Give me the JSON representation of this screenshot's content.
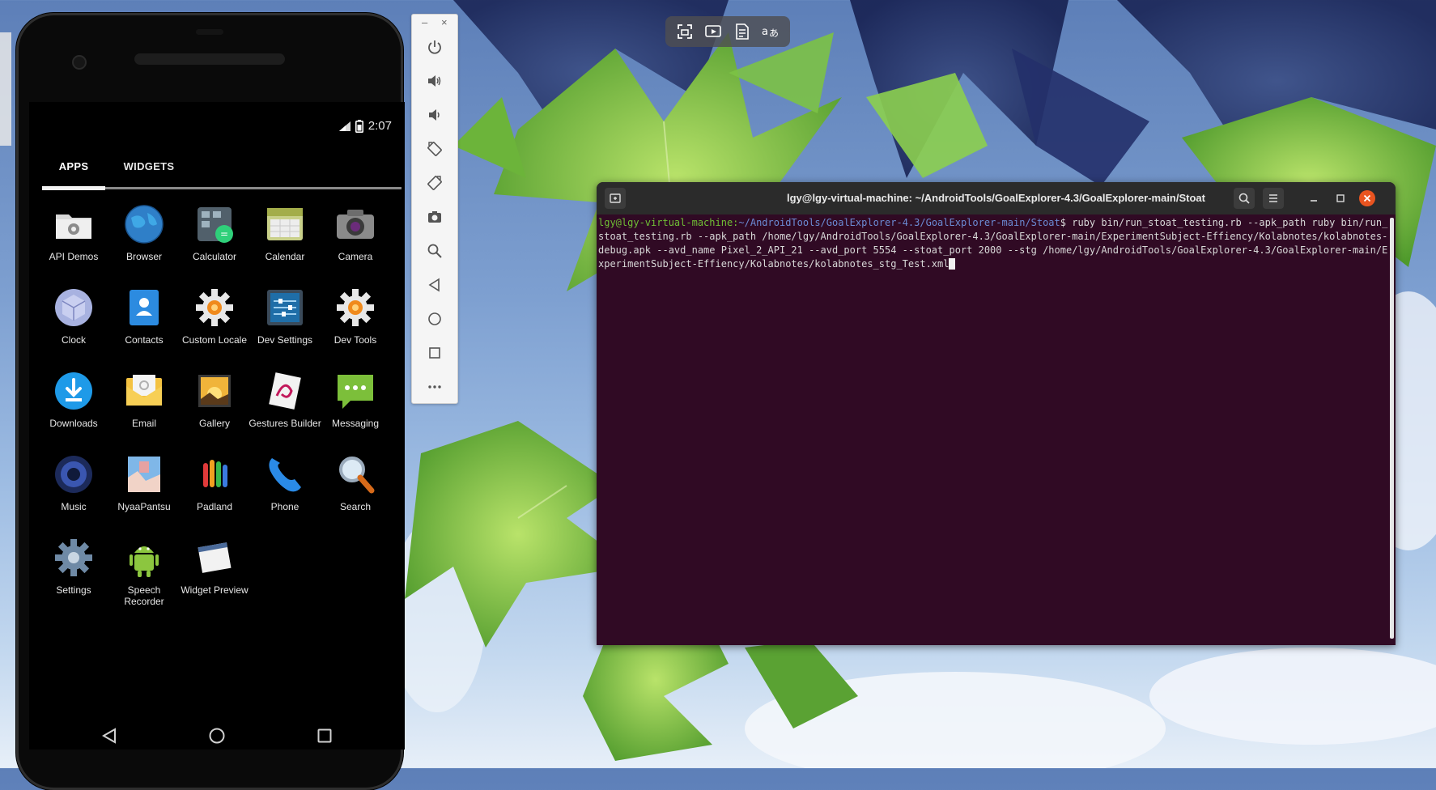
{
  "phone": {
    "status_time": "2:07",
    "tabs": {
      "apps": "APPS",
      "widgets": "WIDGETS"
    },
    "apps": [
      {
        "label": "API Demos",
        "icon": "folder-gear-icon"
      },
      {
        "label": "Browser",
        "icon": "globe-icon"
      },
      {
        "label": "Calculator",
        "icon": "calculator-icon"
      },
      {
        "label": "Calendar",
        "icon": "calendar-icon"
      },
      {
        "label": "Camera",
        "icon": "camera-icon"
      },
      {
        "label": "Clock",
        "icon": "clock-cube-icon"
      },
      {
        "label": "Contacts",
        "icon": "contacts-icon"
      },
      {
        "label": "Custom Locale",
        "icon": "gear-orange-icon"
      },
      {
        "label": "Dev Settings",
        "icon": "dev-settings-icon"
      },
      {
        "label": "Dev Tools",
        "icon": "gear-orange-icon"
      },
      {
        "label": "Downloads",
        "icon": "download-icon"
      },
      {
        "label": "Email",
        "icon": "email-icon"
      },
      {
        "label": "Gallery",
        "icon": "gallery-icon"
      },
      {
        "label": "Gestures Builder",
        "icon": "gestures-icon"
      },
      {
        "label": "Messaging",
        "icon": "messaging-icon"
      },
      {
        "label": "Music",
        "icon": "speaker-icon"
      },
      {
        "label": "NyaaPantsu",
        "icon": "nyaapantsu-icon"
      },
      {
        "label": "Padland",
        "icon": "padland-icon"
      },
      {
        "label": "Phone",
        "icon": "phone-icon"
      },
      {
        "label": "Search",
        "icon": "search-icon"
      },
      {
        "label": "Settings",
        "icon": "settings-gear-icon"
      },
      {
        "label": "Speech Recorder",
        "icon": "android-icon"
      },
      {
        "label": "Widget Preview",
        "icon": "widget-preview-icon"
      }
    ]
  },
  "overlay_toolbar": {
    "icons": [
      "screen-capture-icon",
      "video-capture-icon",
      "text-extract-icon",
      "translate-icon"
    ]
  },
  "emulator_toolbar": {
    "buttons": [
      "power-icon",
      "volume-up-icon",
      "volume-down-icon",
      "rotate-left-icon",
      "rotate-right-icon",
      "screenshot-icon",
      "zoom-icon",
      "back-icon",
      "home-icon",
      "overview-icon",
      "more-icon"
    ]
  },
  "terminal": {
    "title": "lgy@lgy-virtual-machine: ~/AndroidTools/GoalExplorer-4.3/GoalExplorer-main/Stoat",
    "prompt_user": "lgy@lgy-virtual-machine",
    "prompt_sep": ":",
    "prompt_path": "~/AndroidTools/GoalExplorer-4.3/GoalExplorer-main/Stoat",
    "prompt_symbol": "$ ",
    "command": "ruby bin/run_stoat_testing.rb --apk_path ruby bin/run_stoat_testing.rb --apk_path /home/lgy/AndroidTools/GoalExplorer-4.3/GoalExplorer-main/ExperimentSubject-Effiency/Kolabnotes/kolabnotes-debug.apk --avd_name Pixel_2_API_21 --avd_port 5554 --stoat_port 2000 --stg /home/lgy/AndroidTools/GoalExplorer-4.3/GoalExplorer-main/ExperimentSubject-Effiency/Kolabnotes/kolabnotes_stg_Test.xml"
  },
  "colors": {
    "terminal_bg": "#300a24",
    "prompt_user": "#6fbf35",
    "prompt_path": "#6b8bd4",
    "close_button": "#e95420"
  }
}
